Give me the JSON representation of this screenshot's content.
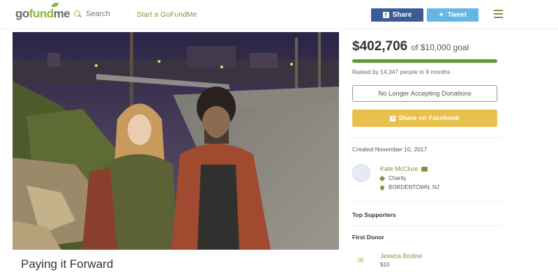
{
  "header": {
    "logo": {
      "part1": "go",
      "part2": "fund",
      "part3": "me"
    },
    "search_label": "Search",
    "start_label": "Start a GoFundMe",
    "share_label": "Share",
    "tweet_label": "Tweet",
    "colors": {
      "brand_green": "#8cb63c",
      "facebook": "#3a5a98",
      "twitter": "#64b6e6"
    }
  },
  "campaign": {
    "title": "Paying it Forward",
    "raised_amount": "$402,706",
    "goal_text": "of $10,000 goal",
    "progress_fraction": 1.0,
    "raised_by": "Raised by 14,347 people in 9 months",
    "no_donations_label": "No Longer Accepting Donations",
    "share_facebook_label": "Share on Facebook",
    "created": "Created November 10, 2017"
  },
  "organizer": {
    "name": "Kate McClure",
    "category": "Charity",
    "location": "BORDENTOWN, NJ"
  },
  "supporters": {
    "top_label": "Top Supporters",
    "first_label": "First Donor",
    "first_donor": {
      "initials": "JB",
      "name": "Jessica Bodine",
      "amount": "$10"
    }
  }
}
